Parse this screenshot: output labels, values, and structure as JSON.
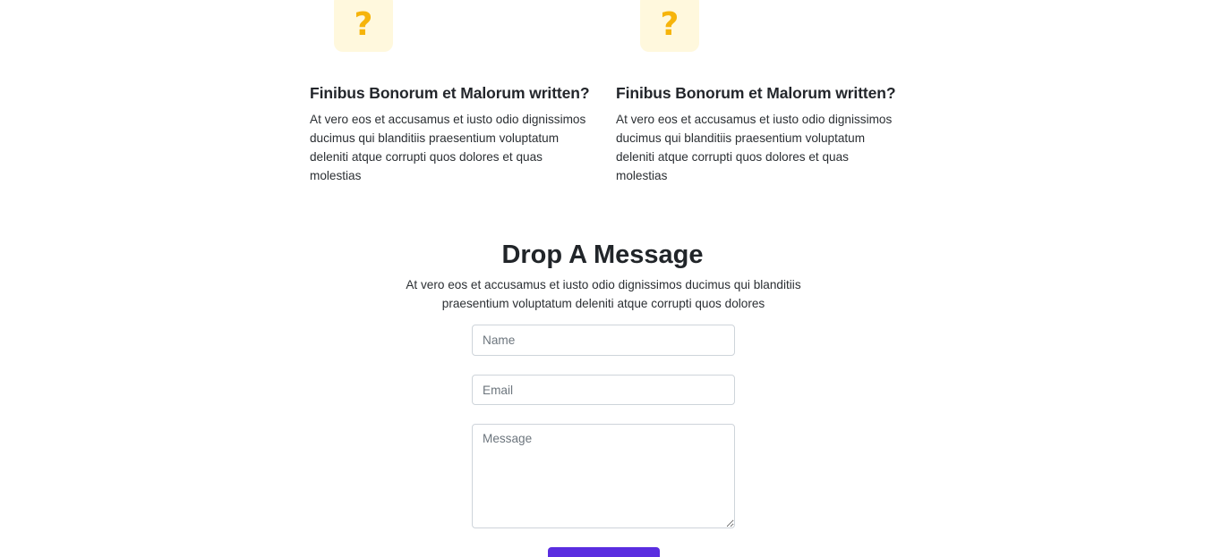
{
  "faq": {
    "items": [
      {
        "icon": "question-mark-icon",
        "icon_glyph": "?",
        "title": "Finibus Bonorum et Malorum written?",
        "text": "At vero eos et accusamus et iusto odio dignissimos ducimus qui blanditiis praesentium voluptatum deleniti atque corrupti quos dolores et quas molestias"
      },
      {
        "icon": "question-mark-icon",
        "icon_glyph": "?",
        "title": "Finibus Bonorum et Malorum written?",
        "text": "At vero eos et accusamus et iusto odio dignissimos ducimus qui blanditiis praesentium voluptatum deleniti atque corrupti quos dolores et quas molestias"
      }
    ]
  },
  "contact": {
    "title": "Drop A Message",
    "text": "At vero eos et accusamus et iusto odio dignissimos ducimus qui blanditiis praesentium voluptatum deleniti atque corrupti quos dolores",
    "name_placeholder": "Name",
    "email_placeholder": "Email",
    "message_placeholder": "Message",
    "submit_label": ""
  },
  "colors": {
    "icon_background": "#fff8dd",
    "icon_accent": "#f6b40b",
    "button_primary": "#5a2ee0",
    "input_border": "#ced4da"
  }
}
